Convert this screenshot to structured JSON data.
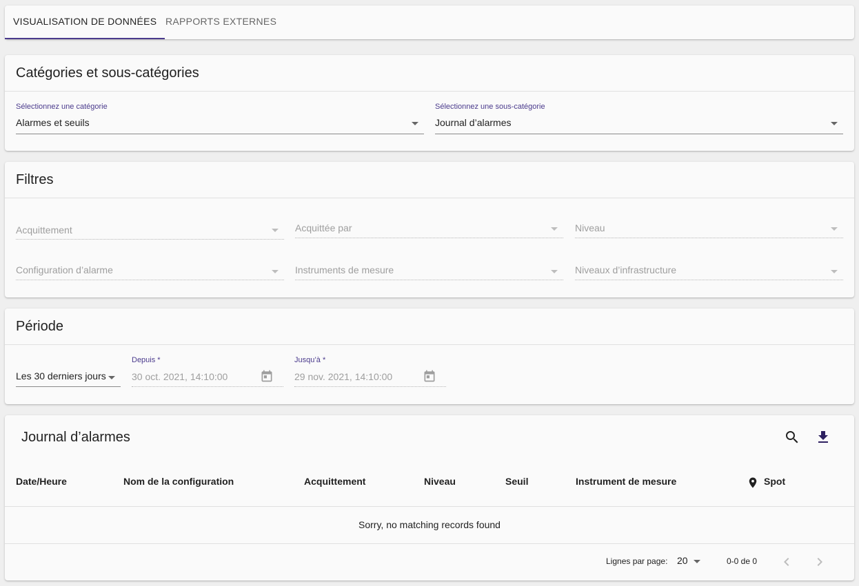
{
  "tabs": [
    {
      "label": "VISUALISATION DE DONNÉES"
    },
    {
      "label": "RAPPORTS EXTERNES"
    }
  ],
  "categories": {
    "title": "Catégories et sous-catégories",
    "category_label": "Sélectionnez une catégorie",
    "category_value": "Alarmes et seuils",
    "subcategory_label": "Sélectionnez une sous-catégorie",
    "subcategory_value": "Journal d’alarmes"
  },
  "filters": {
    "title": "Filtres",
    "items": [
      {
        "placeholder": "Acquittement"
      },
      {
        "placeholder": "Acquittée par"
      },
      {
        "placeholder": "Niveau"
      },
      {
        "placeholder": "Configuration d’alarme"
      },
      {
        "placeholder": "Instruments de mesure"
      },
      {
        "placeholder": "Niveaux d’infrastructure"
      }
    ]
  },
  "period": {
    "title": "Période",
    "range_value": "Les 30 derniers jours",
    "from_label": "Depuis *",
    "from_value": "30 oct. 2021, 14:10:00",
    "to_label": "Jusqu’à *",
    "to_value": "29 nov. 2021, 14:10:00"
  },
  "table": {
    "title": "Journal d’alarmes",
    "columns": [
      "Date/Heure",
      "Nom de la configuration",
      "Acquittement",
      "Niveau",
      "Seuil",
      "Instrument de mesure",
      "Spot"
    ],
    "empty_message": "Sorry, no matching records found",
    "footer": {
      "rows_per_page_label": "Lignes par page:",
      "rows_per_page_value": "20",
      "range_text": "0-0 de 0"
    }
  },
  "colors": {
    "accent": "#4a3a8c",
    "download_icon": "#2d2060"
  }
}
